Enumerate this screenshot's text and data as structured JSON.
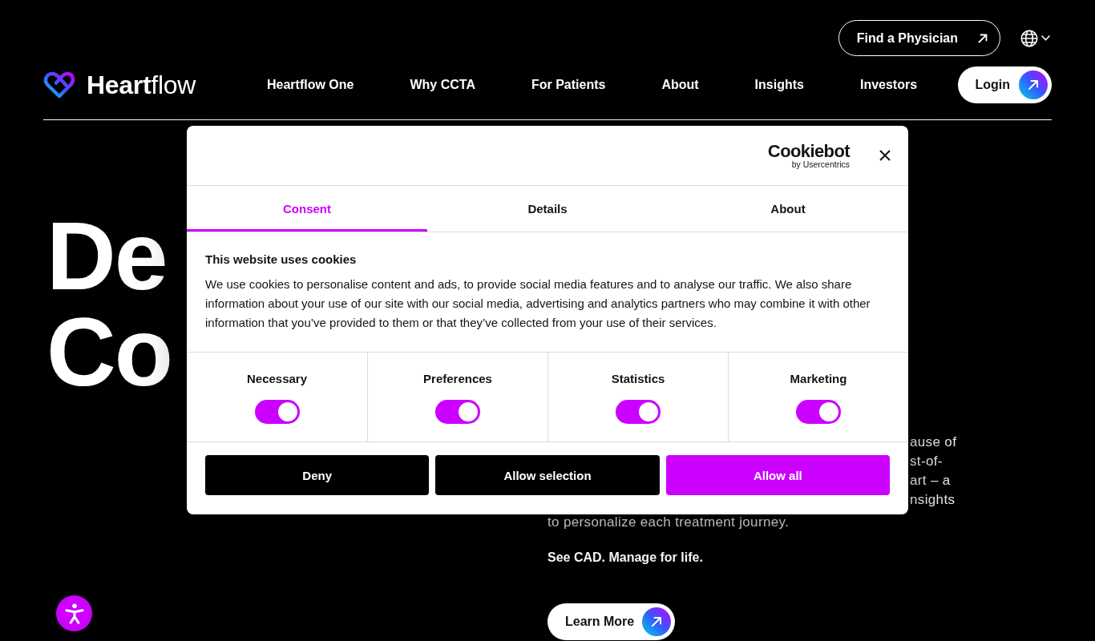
{
  "header": {
    "find_physician_button": {
      "label": "Find a Physician"
    },
    "brand": {
      "name": "**Heart**flow"
    },
    "nav": [
      {
        "label": "Heartflow One"
      },
      {
        "label": "Why CCTA"
      },
      {
        "label": "For Patients"
      },
      {
        "label": "About"
      },
      {
        "label": "Insights"
      },
      {
        "label": "Investors"
      }
    ],
    "login_button": {
      "label": "Login"
    }
  },
  "hero": {
    "heading_lines": [
      "De",
      "Co"
    ],
    "intro_fragments": [
      "ause of",
      "st-of-",
      "art – a",
      "nsights"
    ],
    "intro_last_line": "to personalize each treatment journey.",
    "tagline": "See CAD. Manage for life.",
    "cta_button": {
      "label": "Learn More"
    }
  },
  "cookie_dialog": {
    "provider": {
      "name": "Cookiebot",
      "byline": "by Usercentrics"
    },
    "tabs": [
      {
        "label": "Consent",
        "selected": true
      },
      {
        "label": "Details",
        "selected": false
      },
      {
        "label": "About",
        "selected": false
      }
    ],
    "title": "This website uses cookies",
    "body": "We use cookies to personalise content and ads, to provide social media features and to analyse our traffic. We also share information about your use of our site with our social media, advertising and analytics partners who may combine it with other information that you’ve provided to them or that they’ve collected from your use of their services.",
    "categories": [
      {
        "label": "Necessary",
        "checked": true
      },
      {
        "label": "Preferences",
        "checked": true
      },
      {
        "label": "Statistics",
        "checked": true
      },
      {
        "label": "Marketing",
        "checked": true
      }
    ],
    "buttons": [
      {
        "label": "Deny",
        "kind": "secondary"
      },
      {
        "label": "Allow selection",
        "kind": "secondary"
      },
      {
        "label": "Allow all",
        "kind": "primary"
      }
    ]
  }
}
